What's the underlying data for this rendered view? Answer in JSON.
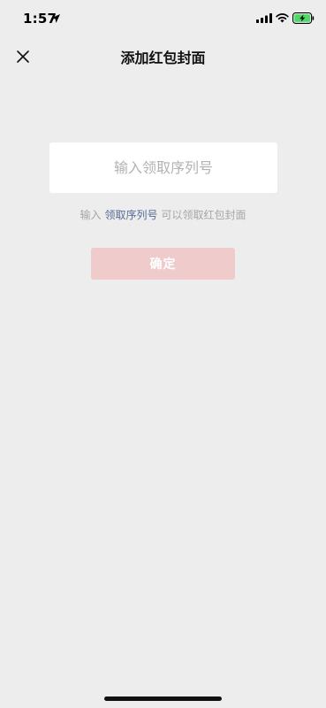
{
  "status_bar": {
    "time": "1:57"
  },
  "nav": {
    "title": "添加红包封面",
    "close_icon": "close-icon"
  },
  "form": {
    "placeholder": "输入领取序列号",
    "value": ""
  },
  "hint": {
    "prefix": "输入",
    "link": "领取序列号",
    "suffix": "可以领取红包封面"
  },
  "confirm": {
    "label": "确定",
    "enabled": false
  },
  "colors": {
    "background": "#ededed",
    "link": "#576b95",
    "confirm_disabled": "#f0cbcb",
    "battery_charge": "#4cd964"
  }
}
